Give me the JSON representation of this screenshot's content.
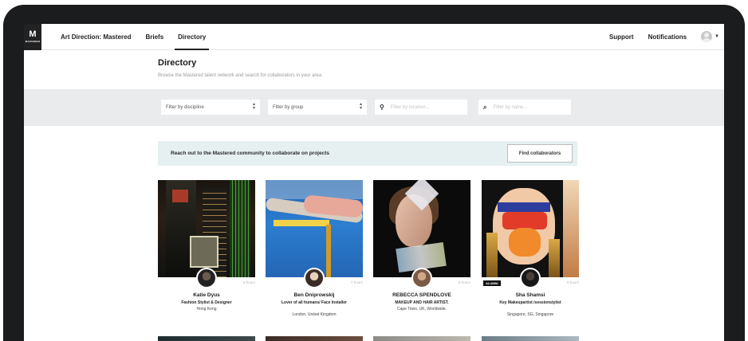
{
  "nav": {
    "logo_letter": "M",
    "logo_sub": "MASTERED",
    "brand": "Art Direction: Mastered",
    "items": [
      "Briefs",
      "Directory"
    ],
    "right_items": [
      "Support",
      "Notifications"
    ]
  },
  "page": {
    "title": "Directory",
    "subtitle": "Browse the Mastered talent network and search for collaborators in your area"
  },
  "filters": {
    "discipline": "Filter by discipline",
    "group": "Filter by group",
    "location_placeholder": "Filter by location...",
    "name_placeholder": "Filter by name..."
  },
  "cta": {
    "text": "Reach out to the Mastered community to collaborate on projects",
    "button": "Find collaborators"
  },
  "cards": [
    {
      "name": "Katie Dyus",
      "role": "Fashion Stylist & Designer",
      "location": "Hong Kong",
      "time": "5 hours"
    },
    {
      "name": "Ben Dniprowskij",
      "role": "Lover of all humans/ Face Installer",
      "location": "London, United Kingdom",
      "time": "7 hours"
    },
    {
      "name": "REBECCA SPENDLOVE",
      "role": "MAKEUP AND HAIR ARTIST.",
      "location": "Cape Town, UK, Worldwide.",
      "time": "8 hours"
    },
    {
      "name": "Sha Shamsi",
      "role": "Key Makeupartist /sessionstylist",
      "location": "Singapore, SG, Singapore",
      "time": "9 hours",
      "badge": "ALUMNI"
    }
  ]
}
